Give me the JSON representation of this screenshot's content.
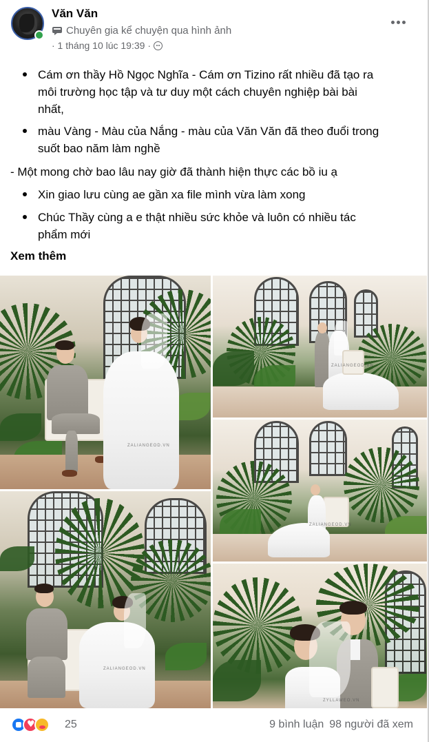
{
  "post": {
    "author": "Văn Văn",
    "badge": "Chuyên gia kể chuyện qua hình ảnh",
    "timestamp": "· 1 tháng 10 lúc 19:39 ·",
    "more_icon": "more-horizontal-icon",
    "privacy_icon": "friends-icon"
  },
  "content": {
    "lines": [
      "Cám ơn thầy Hồ Ngọc Nghĩa - Cám ơn Tizino rất nhiều đã tạo ra",
      "môi trường học tập và tư duy một cách chuyên nghiệp bài bài",
      "nhất,",
      "màu Vàng - Màu của Nắng - màu của Văn Văn đã theo đuổi trong",
      "suốt bao năm làm nghề",
      "- Một mong chờ bao lâu nay giờ đã thành hiện thực các bồ iu ạ",
      "Xin giao lưu cùng ae gần xa file mình vừa làm xong",
      "Chúc Thầy cùng a e thật nhiều sức khỏe và luôn có nhiều tác",
      "phẩm mới"
    ],
    "see_more": "Xem thêm"
  },
  "photos": [
    {
      "name": "photo-couple-bench-garden",
      "watermark": "ZALIANGEOD.VN"
    },
    {
      "name": "photo-couple-hall-windows",
      "watermark": "ZALIANGEOD.VN"
    },
    {
      "name": "photo-bride-bench-hall",
      "watermark": "ZALIANGEOD.VN"
    },
    {
      "name": "photo-couple-seated-garden",
      "watermark": "ZALIANGEOD.VN"
    },
    {
      "name": "photo-couple-closeup",
      "watermark": "ZYLLAWEO.VN"
    }
  ],
  "footer": {
    "reaction_count": "25",
    "reactions": [
      "like",
      "love",
      "care"
    ],
    "comments": "9 bình luận",
    "views": "98 người đã xem"
  }
}
